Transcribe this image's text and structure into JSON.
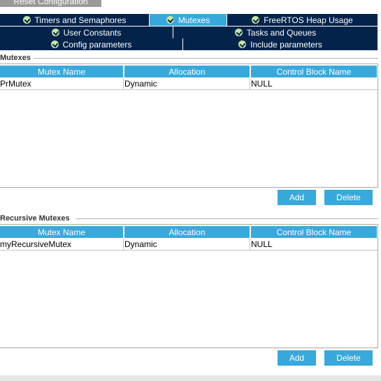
{
  "toolbar": {
    "reset_label": "Reset Configuration"
  },
  "tabs": {
    "row1": [
      {
        "label": "Timers and Semaphores"
      },
      {
        "label": "Mutexes"
      },
      {
        "label": "FreeRTOS Heap Usage"
      }
    ],
    "row2": [
      {
        "label": "User Constants"
      },
      {
        "label": "Tasks and Queues"
      }
    ],
    "row3": [
      {
        "label": "Config parameters"
      },
      {
        "label": "Include parameters"
      }
    ],
    "active": "Mutexes"
  },
  "mutexes": {
    "title": "Mutexes",
    "columns": [
      "Mutex Name",
      "Allocation",
      "Control Block Name"
    ],
    "rows": [
      [
        "PrMutex",
        "Dynamic",
        "NULL"
      ]
    ],
    "add_label": "Add",
    "delete_label": "Delete"
  },
  "recursive_mutexes": {
    "title": "Recursive Mutexes",
    "columns": [
      "Mutex Name",
      "Allocation",
      "Control Block Name"
    ],
    "rows": [
      [
        "myRecursiveMutex",
        "Dynamic",
        "NULL"
      ]
    ],
    "add_label": "Add",
    "delete_label": "Delete"
  },
  "colors": {
    "tab_bg": "#03234b",
    "active_tab": "#39a9dc",
    "header_bg": "#39a9dc",
    "button_bg": "#39a9dc",
    "check_icon": "#c9e4a5"
  }
}
